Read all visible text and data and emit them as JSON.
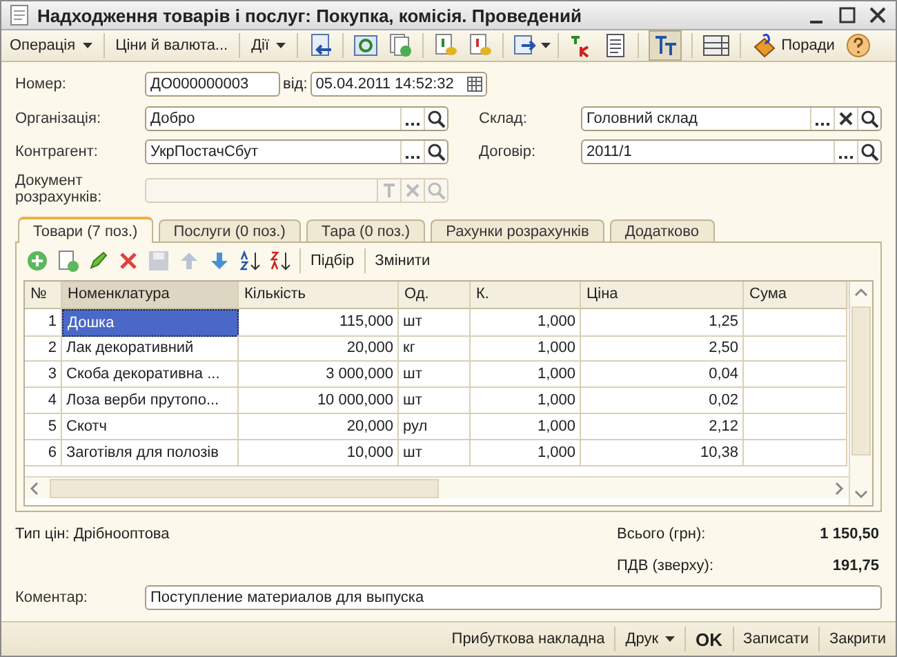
{
  "window": {
    "title": "Надходження товарів і послуг: Покупка, комісія. Проведений"
  },
  "toolbar": {
    "menus": [
      {
        "label": "Операція",
        "dropdown": true
      },
      {
        "label": "Ціни й валюта...",
        "dropdown": false
      },
      {
        "label": "Дії",
        "dropdown": true
      }
    ],
    "tips": "Поради"
  },
  "header": {
    "number_label": "Номер:",
    "number": "ДО000000003",
    "date_label": "від:",
    "date": "05.04.2011 14:52:32"
  },
  "fields": [
    {
      "label": "Організація:",
      "value": "Добро",
      "clearable": false,
      "disabled": false
    },
    {
      "label": "Склад:",
      "value": "Головний склад",
      "clearable": true,
      "disabled": false
    },
    {
      "label": "Контрагент:",
      "value": "УкрПостачСбут",
      "clearable": false,
      "disabled": false
    },
    {
      "label": "Договір:",
      "value": "2011/1",
      "clearable": false,
      "disabled": false
    },
    {
      "label": "Документ розрахунків:",
      "clearable": true,
      "disabled": true
    }
  ],
  "tabs": [
    {
      "label": "Товари (7 поз.)",
      "selected": true
    },
    {
      "label": "Послуги (0 поз.)",
      "selected": false
    },
    {
      "label": "Тара (0 поз.)",
      "selected": false
    },
    {
      "label": "Рахунки розрахунків",
      "selected": false
    },
    {
      "label": "Додатково",
      "selected": false
    }
  ],
  "table_toolbar": [
    "Підбір",
    "Змінити"
  ],
  "table": {
    "columns": [
      "№",
      "Номенклатура",
      "Кількість",
      "Од.",
      "К.",
      "Ціна",
      "Сума"
    ],
    "rows": [
      {
        "cells": [
          "1",
          "Дошка",
          "115,000",
          "шт",
          "1,000",
          "1,25"
        ],
        "selected": true
      },
      {
        "cells": [
          "2",
          "Лак декоративний",
          "20,000",
          "кг",
          "1,000",
          "2,50"
        ],
        "selected": false
      },
      {
        "cells": [
          "3",
          "Скоба декоративна ...",
          "3 000,000",
          "шт",
          "1,000",
          "0,04"
        ],
        "selected": false
      },
      {
        "cells": [
          "4",
          "Лоза верби прутопо...",
          "10 000,000",
          "шт",
          "1,000",
          "0,02"
        ],
        "selected": false
      },
      {
        "cells": [
          "5",
          "Скотч",
          "20,000",
          "рул",
          "1,000",
          "2,12"
        ],
        "selected": false
      },
      {
        "cells": [
          "6",
          "Заготівля для полозів",
          "10,000",
          "шт",
          "1,000",
          "10,38"
        ],
        "selected": false
      }
    ]
  },
  "price_type": "Тип цін: Дрібнооптова",
  "totals": [
    {
      "label": "Всього (грн):",
      "value": "1 150,50"
    },
    {
      "label": "ПДВ (зверху):",
      "value": "191,75"
    }
  ],
  "comment": {
    "label": "Коментар:",
    "value": "Поступление материалов для выпуска"
  },
  "buttons": [
    {
      "label": "Прибуткова накладна",
      "dropdown": false,
      "default": false
    },
    {
      "label": "Друк",
      "dropdown": true,
      "default": false
    },
    {
      "label": "OK",
      "dropdown": false,
      "default": true
    },
    {
      "label": "Записати",
      "dropdown": false,
      "default": false
    },
    {
      "label": "Закрити",
      "dropdown": false,
      "default": false
    }
  ]
}
